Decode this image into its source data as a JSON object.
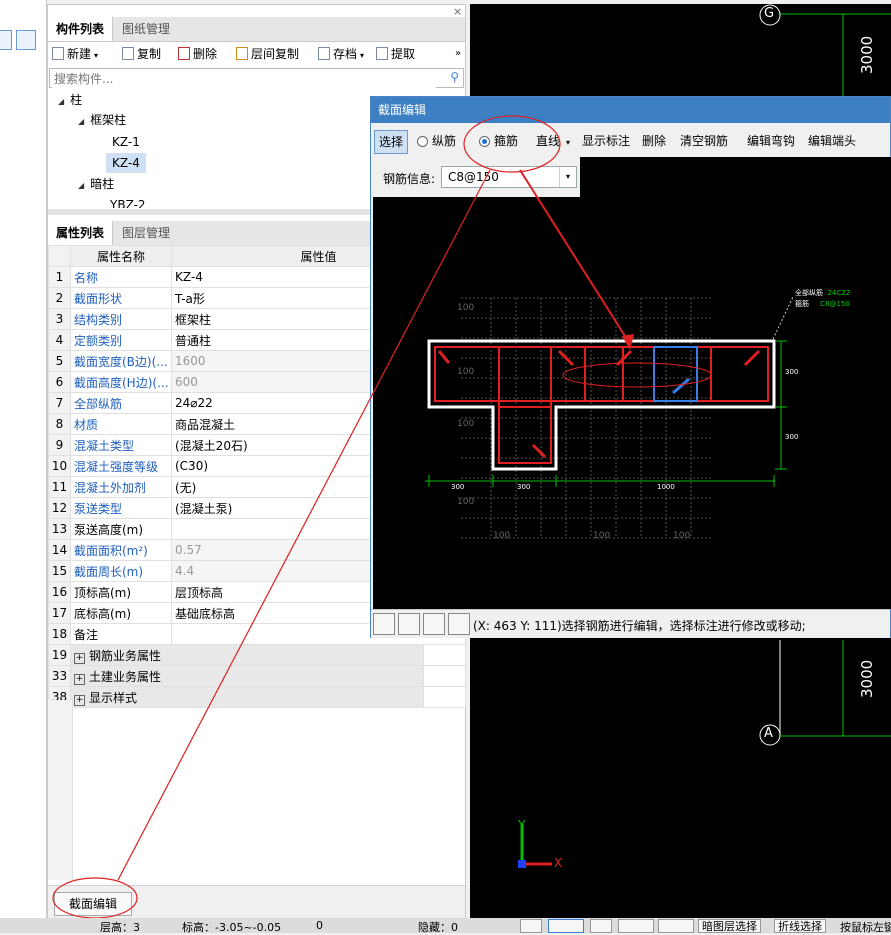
{
  "left_panel": {
    "top_tabs": [
      "构件列表",
      "图纸管理"
    ],
    "toolbar": {
      "new": "新建",
      "copy": "复制",
      "delete": "删除",
      "floor_copy": "层间复制",
      "archive": "存档",
      "extract": "提取",
      "more": "»"
    },
    "search_placeholder": "搜索构件...",
    "tree": {
      "column": "柱",
      "frame_column": "框架柱",
      "kz1": "KZ-1",
      "kz4": "KZ-4",
      "hidden_column": "暗柱",
      "ybz2": "YBZ-2"
    },
    "prop_tabs": [
      "属性列表",
      "图层管理"
    ],
    "prop_headers": {
      "name": "属性名称",
      "value": "属性值"
    },
    "rows": [
      {
        "num": "1",
        "name": "名称",
        "value": "KZ-4",
        "style": "blue"
      },
      {
        "num": "2",
        "name": "截面形状",
        "value": "T-a形",
        "style": "blue"
      },
      {
        "num": "3",
        "name": "结构类别",
        "value": "框架柱",
        "style": "blue"
      },
      {
        "num": "4",
        "name": "定额类别",
        "value": "普通柱",
        "style": "blue"
      },
      {
        "num": "5",
        "name": "截面宽度(B边)(...",
        "value": "1600",
        "style": "gray"
      },
      {
        "num": "6",
        "name": "截面高度(H边)(...",
        "value": "600",
        "style": "gray"
      },
      {
        "num": "7",
        "name": "全部纵筋",
        "value": "24⌀22",
        "style": "blue"
      },
      {
        "num": "8",
        "name": "材质",
        "value": "商品混凝土",
        "style": "blue"
      },
      {
        "num": "9",
        "name": "混凝土类型",
        "value": "(混凝土20石)",
        "style": "blue"
      },
      {
        "num": "10",
        "name": "混凝土强度等级",
        "value": "(C30)",
        "style": "blue"
      },
      {
        "num": "11",
        "name": "混凝土外加剂",
        "value": "(无)",
        "style": "blue"
      },
      {
        "num": "12",
        "name": "泵送类型",
        "value": "(混凝土泵)",
        "style": "blue"
      },
      {
        "num": "13",
        "name": "泵送高度(m)",
        "value": "",
        "style": ""
      },
      {
        "num": "14",
        "name": "截面面积(m²)",
        "value": "0.57",
        "style": "gray"
      },
      {
        "num": "15",
        "name": "截面周长(m)",
        "value": "4.4",
        "style": "gray"
      },
      {
        "num": "16",
        "name": "顶标高(m)",
        "value": "层顶标高",
        "style": ""
      },
      {
        "num": "17",
        "name": "底标高(m)",
        "value": "基础底标高",
        "style": ""
      },
      {
        "num": "18",
        "name": "备注",
        "value": "",
        "style": ""
      }
    ],
    "groups": [
      {
        "num": "19",
        "name": "钢筋业务属性"
      },
      {
        "num": "33",
        "name": "土建业务属性"
      },
      {
        "num": "38",
        "name": "显示样式"
      }
    ],
    "section_edit_button": "截面编辑"
  },
  "dialog": {
    "title": "截面编辑",
    "toolbar": {
      "select": "选择",
      "longitudinal": "纵筋",
      "stirrup": "箍筋",
      "line": "直线",
      "show_annotation": "显示标注",
      "delete": "删除",
      "clear_rebar": "清空钢筋",
      "edit_hook": "编辑弯钩",
      "edit_end": "编辑端头"
    },
    "rebar_info_label": "钢筋信息:",
    "rebar_info_value": "C8@150",
    "status_text": "(X: 463 Y: 111)选择钢筋进行编辑，选择标注进行修改或移动;",
    "drawing": {
      "legend_line1_label": "全部纵筋",
      "legend_line1_value": "24C22",
      "legend_line2_label": "箍筋",
      "legend_line2_value": "C8@150",
      "dim_right_1": "300",
      "dim_right_2": "300",
      "dim_bottom_1": "300",
      "dim_bottom_2": "300",
      "dim_bottom_3": "1000",
      "grid_label": "100"
    }
  },
  "cad": {
    "axis_top": "G",
    "axis_bottom": "A",
    "dim_top": "3000",
    "dim_bottom": "3000",
    "y_label": "Y",
    "x_label": "X"
  },
  "statusbar": {
    "floor": "层高：3",
    "elev": "标高：-3.05~-0.05",
    "zero": "0",
    "hidden": "隐藏：0",
    "btn_hidden_layer": "暗图层选择",
    "btn_polyline": "折线选择",
    "truncated": "按鼠标左键"
  }
}
